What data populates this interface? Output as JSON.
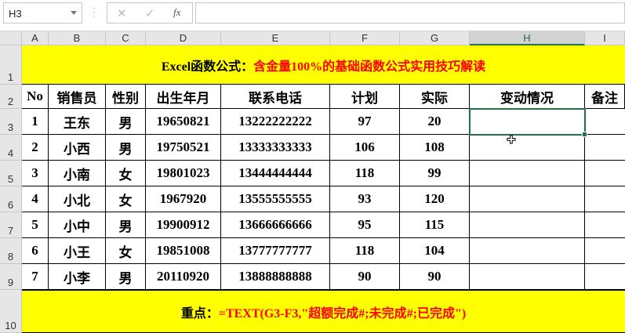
{
  "formula_bar": {
    "name_box": "H3",
    "cancel_icon": "✕",
    "enter_icon": "✓",
    "fx_label": "fx",
    "formula": ""
  },
  "columns": [
    "A",
    "B",
    "C",
    "D",
    "E",
    "F",
    "G",
    "H",
    "I"
  ],
  "rows": [
    "1",
    "2",
    "3",
    "4",
    "5",
    "6",
    "7",
    "8",
    "9",
    "10"
  ],
  "title": {
    "black": "Excel函数公式：",
    "red": "含金量100%的基础函数公式实用技巧解读"
  },
  "headers": [
    "No",
    "销售员",
    "性别",
    "出生年月",
    "联系电话",
    "计划",
    "实际",
    "变动情况",
    "备注"
  ],
  "data": [
    [
      "1",
      "王东",
      "男",
      "19650821",
      "13222222222",
      "97",
      "20",
      "",
      ""
    ],
    [
      "2",
      "小西",
      "男",
      "19750521",
      "13333333333",
      "106",
      "108",
      "",
      ""
    ],
    [
      "3",
      "小南",
      "女",
      "19801023",
      "13444444444",
      "118",
      "99",
      "",
      ""
    ],
    [
      "4",
      "小北",
      "女",
      "1967920",
      "13555555555",
      "93",
      "120",
      "",
      ""
    ],
    [
      "5",
      "小中",
      "男",
      "19900912",
      "13666666666",
      "95",
      "115",
      "",
      ""
    ],
    [
      "6",
      "小王",
      "女",
      "19851008",
      "13777777777",
      "118",
      "104",
      "",
      ""
    ],
    [
      "7",
      "小李",
      "男",
      "20110920",
      "13888888888",
      "90",
      "90",
      "",
      ""
    ]
  ],
  "footer": {
    "black": "重点：",
    "red": "=TEXT(G3-F3,\"超额完成#;未完成#;已完成\")"
  },
  "selected_cell": "H3"
}
